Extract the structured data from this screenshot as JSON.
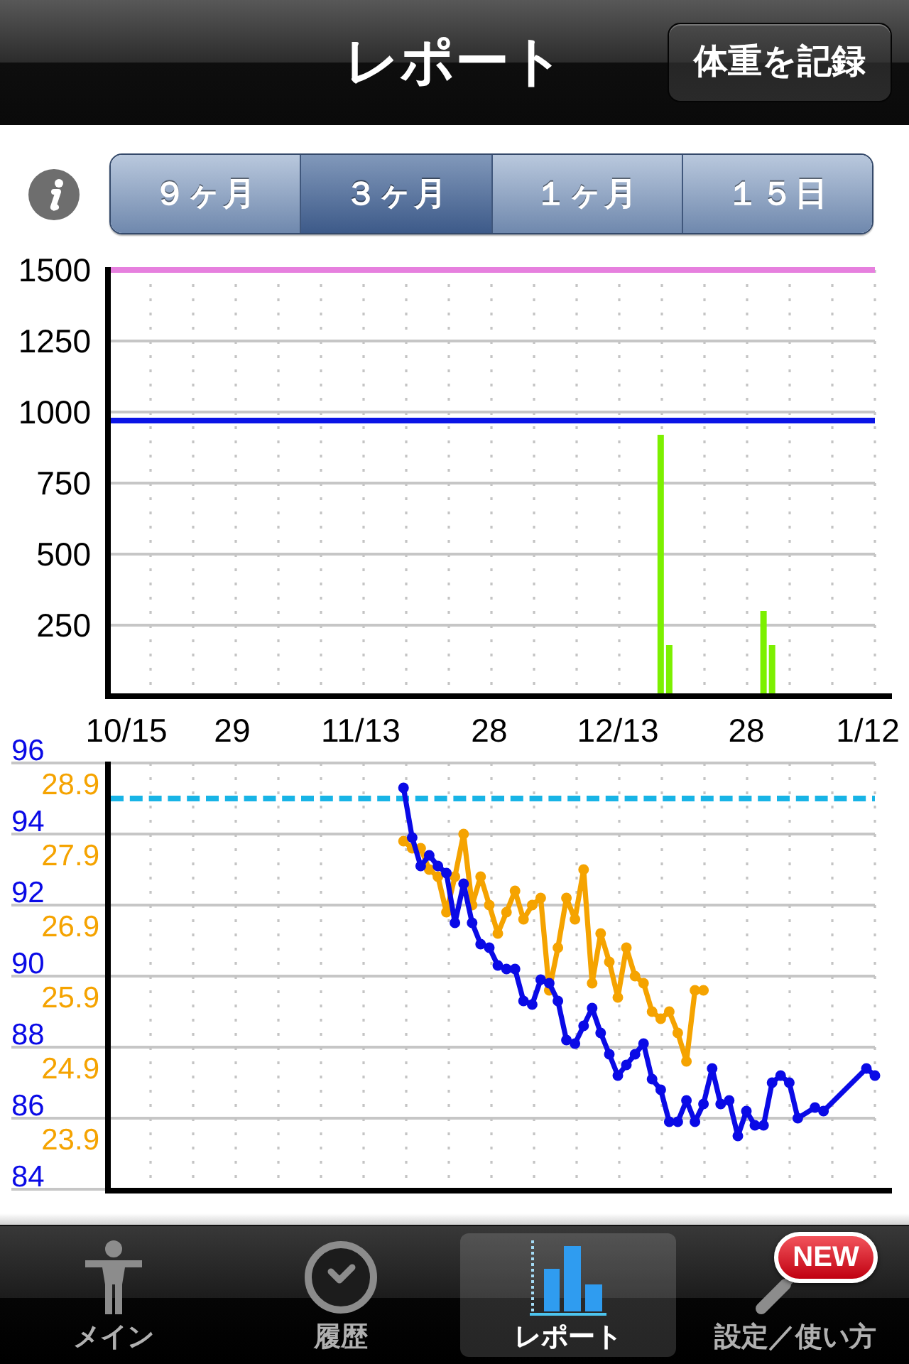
{
  "nav_bar": {
    "title": "レポート",
    "button": "体重を記録"
  },
  "period_selector": {
    "segments": [
      {
        "label": "９ヶ月",
        "selected": false
      },
      {
        "label": "３ヶ月",
        "selected": true
      },
      {
        "label": "１ヶ月",
        "selected": false
      },
      {
        "label": "１５日",
        "selected": false
      }
    ]
  },
  "bar_chart": {
    "chart_data": {
      "type": "bar",
      "categories": [
        "10/15",
        null,
        null,
        null,
        null,
        null,
        null,
        null,
        null,
        null,
        null,
        null,
        null,
        null,
        "29",
        null,
        null,
        null,
        null,
        null,
        null,
        null,
        null,
        null,
        null,
        null,
        null,
        null,
        null,
        "11/13",
        null,
        null,
        null,
        null,
        null,
        null,
        null,
        null,
        null,
        null,
        null,
        null,
        null,
        null,
        "28",
        null,
        null,
        null,
        null,
        null,
        null,
        null,
        null,
        null,
        null,
        null,
        null,
        null,
        null,
        "12/13",
        null,
        null,
        null,
        null,
        null,
        null,
        null,
        null,
        null,
        null,
        null,
        null,
        null,
        null,
        "28",
        null,
        null,
        null,
        null,
        null,
        null,
        null,
        null,
        null,
        null,
        null,
        null,
        null,
        null,
        "1/12"
      ],
      "series": [
        {
          "color": "#7cf000",
          "values": [
            null,
            null,
            null,
            null,
            null,
            null,
            null,
            null,
            null,
            null,
            null,
            null,
            null,
            null,
            null,
            null,
            null,
            null,
            null,
            null,
            null,
            null,
            null,
            null,
            null,
            null,
            null,
            null,
            null,
            null,
            null,
            null,
            null,
            null,
            null,
            null,
            null,
            null,
            null,
            null,
            null,
            null,
            null,
            null,
            null,
            null,
            null,
            null,
            null,
            null,
            null,
            null,
            null,
            null,
            null,
            null,
            null,
            null,
            null,
            null,
            null,
            null,
            null,
            null,
            920,
            180,
            null,
            null,
            null,
            null,
            null,
            null,
            null,
            null,
            null,
            null,
            300,
            180,
            null,
            null,
            null,
            null,
            null,
            null,
            null,
            null,
            null,
            null,
            null,
            null
          ]
        }
      ],
      "ylim": [
        0,
        1500
      ],
      "yticks": [
        250,
        500,
        750,
        1000,
        1250,
        1500
      ],
      "grid": true,
      "ref_lines": [
        {
          "axis": "y",
          "value": 1500,
          "color": "#e680de"
        },
        {
          "axis": "y",
          "value": 970,
          "color": "#0a14e6"
        }
      ]
    }
  },
  "line_chart": {
    "chart_data": {
      "type": "line",
      "categories": [
        null,
        null,
        null,
        null,
        null,
        null,
        null,
        null,
        null,
        null,
        null,
        null,
        null,
        null,
        null,
        null,
        null,
        null,
        null,
        null,
        null,
        null,
        null,
        null,
        null,
        null,
        null,
        null,
        null,
        null,
        null,
        null,
        null,
        null,
        null,
        null,
        null,
        null,
        null,
        null,
        null,
        null,
        null,
        null,
        null,
        null,
        null,
        null,
        null,
        null,
        null,
        null,
        null,
        null,
        null,
        null,
        null,
        null,
        null,
        null,
        null,
        null,
        null,
        null,
        null,
        null,
        null,
        null,
        null,
        null,
        null,
        null,
        null,
        null,
        null,
        null,
        null,
        null,
        null,
        null,
        null,
        null,
        null,
        null,
        null,
        null,
        null,
        null,
        null,
        null
      ],
      "series": [
        {
          "color": "#0a0ae6",
          "values": [
            null,
            null,
            null,
            null,
            null,
            null,
            null,
            null,
            null,
            null,
            null,
            null,
            null,
            null,
            null,
            null,
            null,
            null,
            null,
            null,
            null,
            null,
            null,
            null,
            null,
            null,
            null,
            null,
            null,
            null,
            null,
            null,
            null,
            null,
            95.3,
            93.9,
            93.1,
            93.4,
            93.1,
            92.9,
            91.5,
            92.6,
            91.5,
            90.9,
            90.8,
            90.3,
            90.2,
            90.2,
            89.3,
            89.2,
            89.9,
            89.8,
            89.3,
            88.2,
            88.1,
            88.6,
            89.1,
            88.4,
            87.8,
            87.2,
            87.5,
            87.8,
            88.1,
            87.1,
            86.8,
            85.9,
            85.9,
            86.5,
            85.9,
            86.4,
            87.4,
            86.4,
            86.5,
            85.5,
            86.2,
            85.8,
            85.8,
            87,
            87.2,
            87,
            86,
            null,
            86.3,
            86.2,
            null,
            null,
            null,
            null,
            87.4,
            87.2
          ]
        },
        {
          "color": "#f5a300",
          "axis": "y2",
          "values": [
            null,
            null,
            null,
            null,
            null,
            null,
            null,
            null,
            null,
            null,
            null,
            null,
            null,
            null,
            null,
            null,
            null,
            null,
            null,
            null,
            null,
            null,
            null,
            null,
            null,
            null,
            null,
            null,
            null,
            null,
            null,
            null,
            null,
            null,
            27.8,
            27.7,
            27.7,
            27.4,
            27.3,
            26.8,
            27.3,
            27.9,
            26.9,
            27.3,
            26.9,
            26.5,
            26.8,
            27.1,
            26.7,
            26.9,
            27,
            25.7,
            26.3,
            27,
            26.7,
            27.4,
            25.8,
            26.5,
            26.1,
            25.6,
            26.3,
            25.9,
            25.8,
            25.4,
            25.3,
            25.4,
            25.1,
            24.7,
            25.7,
            25.7,
            null,
            null,
            null,
            null,
            null,
            null,
            null,
            null,
            null,
            null,
            null,
            null,
            null,
            null,
            null,
            null,
            null,
            null,
            null,
            null
          ]
        }
      ],
      "ylim": [
        84,
        96
      ],
      "yticks": [
        84,
        86,
        88,
        90,
        92,
        94,
        96
      ],
      "y2lim": [
        22.9,
        28.9
      ],
      "y2ticks": [
        23.9,
        24.9,
        25.9,
        26.9,
        27.9,
        28.9
      ],
      "grid": true,
      "ref_lines": [
        {
          "axis": "y",
          "value": 95,
          "color": "#18b4e6"
        }
      ]
    }
  },
  "tab_bar": {
    "tabs": [
      {
        "label": "メイン",
        "selected": false
      },
      {
        "label": "履歴",
        "selected": false
      },
      {
        "label": "レポート",
        "selected": true
      },
      {
        "label": "設定／使い方",
        "selected": false,
        "badge": "NEW"
      }
    ]
  }
}
